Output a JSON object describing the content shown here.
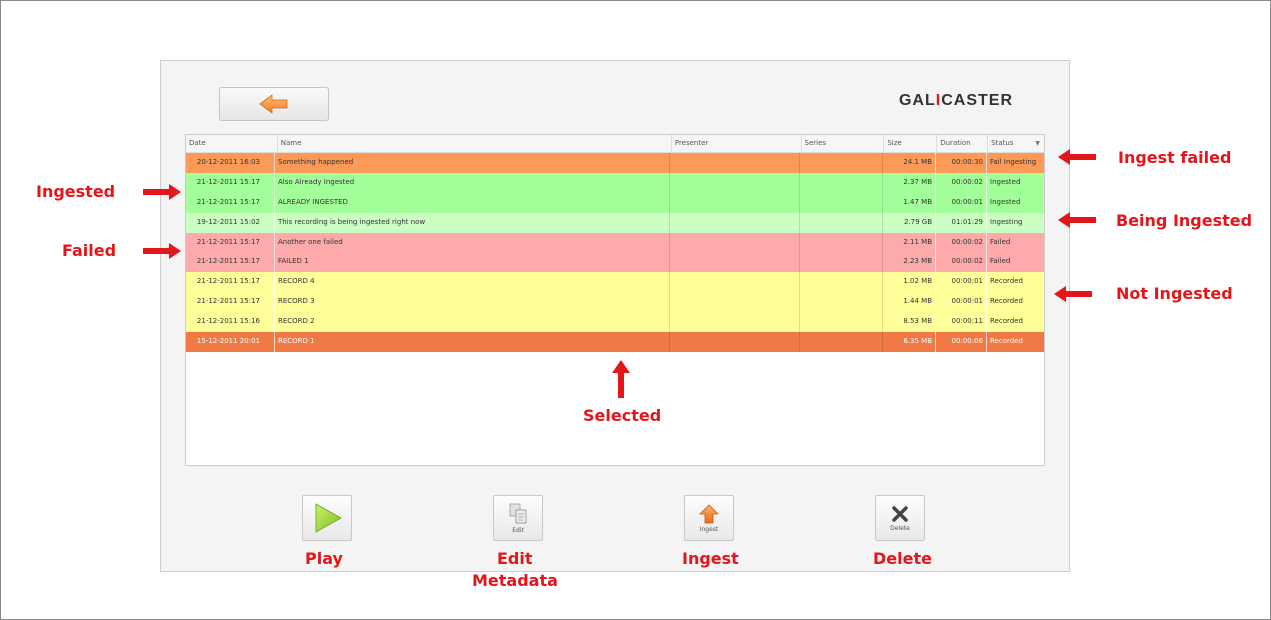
{
  "app": {
    "brand_left": "GAL",
    "brand_dot": "I",
    "brand_right": "CASTER"
  },
  "columns": [
    "Date",
    "Name",
    "Presenter",
    "Series",
    "Size",
    "Duration",
    "Status"
  ],
  "rows": [
    {
      "date": "20-12-2011 16:03",
      "name": "Something happened",
      "presenter": "",
      "series": "",
      "size": "24.1 MB",
      "duration": "00:00:30",
      "status": "Fail Ingesting"
    },
    {
      "date": "21-12-2011 15:17",
      "name": "Also Already Ingested",
      "presenter": "",
      "series": "",
      "size": "2.37 MB",
      "duration": "00:00:02",
      "status": "Ingested"
    },
    {
      "date": "21-12-2011 15:17",
      "name": "ALREADY INGESTED",
      "presenter": "",
      "series": "",
      "size": "1.47 MB",
      "duration": "00:00:01",
      "status": "Ingested"
    },
    {
      "date": "19-12-2011 15:02",
      "name": "This recording is being ingested right now",
      "presenter": "",
      "series": "",
      "size": "2.79 GB",
      "duration": "01:01:29",
      "status": "Ingesting"
    },
    {
      "date": "21-12-2011 15:17",
      "name": "Another one failed",
      "presenter": "",
      "series": "",
      "size": "2.11 MB",
      "duration": "00:00:02",
      "status": "Failed"
    },
    {
      "date": "21-12-2011 15:17",
      "name": "FAILED 1",
      "presenter": "",
      "series": "",
      "size": "2.23 MB",
      "duration": "00:00:02",
      "status": "Failed"
    },
    {
      "date": "21-12-2011 15:17",
      "name": "RECORD 4",
      "presenter": "",
      "series": "",
      "size": "1.02 MB",
      "duration": "00:00:01",
      "status": "Recorded"
    },
    {
      "date": "21-12-2011 15:17",
      "name": "RECORD 3",
      "presenter": "",
      "series": "",
      "size": "1.44 MB",
      "duration": "00:00:01",
      "status": "Recorded"
    },
    {
      "date": "21-12-2011 15:16",
      "name": "RECORD 2",
      "presenter": "",
      "series": "",
      "size": "8.53 MB",
      "duration": "00:00:11",
      "status": "Recorded"
    },
    {
      "date": "15-12-2011 20:01",
      "name": "RECORD 1",
      "presenter": "",
      "series": "",
      "size": "6.35 MB",
      "duration": "00:00:06",
      "status": "Recorded"
    }
  ],
  "toolbar": {
    "edit_label": "Edit",
    "ingest_label": "Ingest",
    "delete_label": "Delete"
  },
  "annotations": {
    "ingest_failed": "Ingest failed",
    "ingested": "Ingested",
    "being_ingested": "Being Ingested",
    "failed": "Failed",
    "not_ingested": "Not Ingested",
    "selected": "Selected",
    "play": "Play",
    "edit_metadata_1": "Edit",
    "edit_metadata_2": "Metadata",
    "ingest": "Ingest",
    "delete": "Delete"
  },
  "colors": {
    "fail_ingesting": "#fd9a57",
    "ingested": "#a3ff99",
    "ingesting": "#ccffc2",
    "failed": "#ffaaaa",
    "recorded": "#ffff99",
    "selected": "#f07a45",
    "annotation": "#e3161b"
  },
  "icons": {
    "back": "arrow-left-icon",
    "play": "play-icon",
    "edit": "document-edit-icon",
    "ingest": "upload-arrow-icon",
    "delete": "close-x-icon",
    "sort": "sort-down-icon",
    "annotation_arrow": "red-arrow-icon"
  }
}
